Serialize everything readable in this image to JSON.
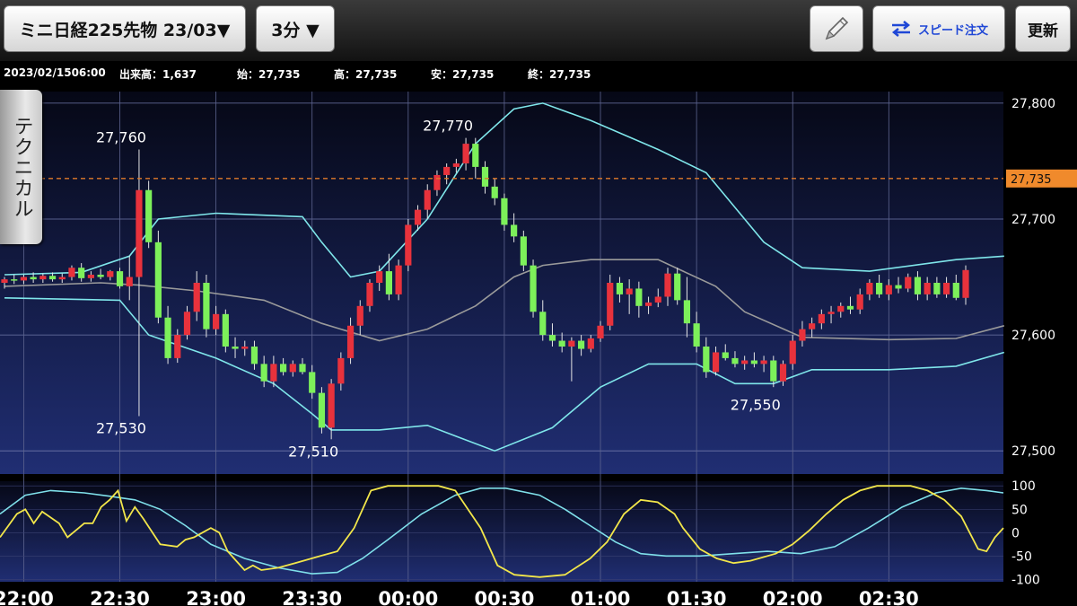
{
  "toolbar": {
    "instrument": "ミニ日経225先物 23/03▼",
    "interval": "3分 ▼",
    "speed_order": "スピード注文",
    "update": "更新"
  },
  "ohlc": {
    "datetime": "2023/02/1506:00",
    "volume": "出来高：1,637",
    "open": "始：27,735",
    "high": "高：27,735",
    "low": "安：27,735",
    "close": "終：27,735"
  },
  "side_tab": "テクニカル",
  "colors": {
    "up": "#e8323c",
    "down": "#7df05a",
    "band": "#7fe6ea",
    "mid": "#9a9a9a",
    "osc_yellow": "#f2e64a",
    "osc_cyan": "#7fe0ea",
    "price_line": "#e07a2a"
  },
  "current_price": "27,735",
  "chart_data": {
    "type": "candlestick",
    "price_axis": {
      "ylim": [
        27480,
        27810
      ],
      "ticks": [
        27800,
        27700,
        27600,
        27500
      ],
      "tick_labels": [
        "27,800",
        "27,700",
        "27,600",
        "27,500"
      ]
    },
    "osc_axis": {
      "ylim": [
        -105,
        110
      ],
      "ticks": [
        100,
        50,
        0,
        -50,
        -100
      ],
      "tick_labels": [
        "100",
        "50",
        "0",
        "-50",
        "-100"
      ]
    },
    "time_labels": [
      {
        "idx": 2,
        "label": "22:00"
      },
      {
        "idx": 12,
        "label": "22:30"
      },
      {
        "idx": 22,
        "label": "23:00"
      },
      {
        "idx": 32,
        "label": "23:30"
      },
      {
        "idx": 42,
        "label": "00:00"
      },
      {
        "idx": 52,
        "label": "00:30"
      },
      {
        "idx": 62,
        "label": "01:00"
      },
      {
        "idx": 72,
        "label": "01:30"
      },
      {
        "idx": 82,
        "label": "02:00"
      },
      {
        "idx": 92,
        "label": "02:30"
      }
    ],
    "annotations": [
      {
        "idx": 14,
        "price": 27760,
        "label": "27,760",
        "pos": "above"
      },
      {
        "idx": 14,
        "price": 27530,
        "label": "27,530",
        "pos": "below"
      },
      {
        "idx": 34,
        "price": 27510,
        "label": "27,510",
        "pos": "below"
      },
      {
        "idx": 48,
        "price": 27770,
        "label": "27,770",
        "pos": "above"
      },
      {
        "idx": 80,
        "price": 27550,
        "label": "27,550",
        "pos": "below"
      }
    ],
    "candles": [
      [
        27645,
        27650,
        27640,
        27648
      ],
      [
        27648,
        27652,
        27644,
        27647
      ],
      [
        27647,
        27652,
        27644,
        27650
      ],
      [
        27650,
        27654,
        27645,
        27648
      ],
      [
        27648,
        27653,
        27645,
        27651
      ],
      [
        27651,
        27654,
        27646,
        27648
      ],
      [
        27648,
        27653,
        27645,
        27650
      ],
      [
        27650,
        27660,
        27647,
        27658
      ],
      [
        27658,
        27662,
        27646,
        27649
      ],
      [
        27649,
        27655,
        27646,
        27652
      ],
      [
        27652,
        27657,
        27648,
        27650
      ],
      [
        27650,
        27656,
        27647,
        27655
      ],
      [
        27655,
        27658,
        27640,
        27642
      ],
      [
        27642,
        27668,
        27630,
        27650
      ],
      [
        27650,
        27760,
        27530,
        27725
      ],
      [
        27725,
        27733,
        27675,
        27680
      ],
      [
        27680,
        27690,
        27610,
        27615
      ],
      [
        27615,
        27625,
        27575,
        27580
      ],
      [
        27580,
        27605,
        27576,
        27600
      ],
      [
        27600,
        27625,
        27596,
        27620
      ],
      [
        27620,
        27655,
        27612,
        27645
      ],
      [
        27645,
        27652,
        27598,
        27605
      ],
      [
        27605,
        27625,
        27600,
        27618
      ],
      [
        27618,
        27622,
        27585,
        27590
      ],
      [
        27590,
        27598,
        27580,
        27588
      ],
      [
        27588,
        27595,
        27582,
        27590
      ],
      [
        27590,
        27595,
        27570,
        27575
      ],
      [
        27575,
        27582,
        27555,
        27560
      ],
      [
        27560,
        27582,
        27555,
        27575
      ],
      [
        27575,
        27580,
        27565,
        27568
      ],
      [
        27568,
        27578,
        27564,
        27575
      ],
      [
        27575,
        27580,
        27566,
        27568
      ],
      [
        27568,
        27574,
        27545,
        27550
      ],
      [
        27550,
        27555,
        27515,
        27520
      ],
      [
        27520,
        27562,
        27510,
        27558
      ],
      [
        27558,
        27585,
        27552,
        27580
      ],
      [
        27580,
        27615,
        27575,
        27608
      ],
      [
        27608,
        27630,
        27600,
        27625
      ],
      [
        27625,
        27648,
        27620,
        27645
      ],
      [
        27645,
        27660,
        27638,
        27655
      ],
      [
        27655,
        27670,
        27630,
        27635
      ],
      [
        27635,
        27665,
        27630,
        27660
      ],
      [
        27660,
        27700,
        27655,
        27695
      ],
      [
        27695,
        27712,
        27690,
        27708
      ],
      [
        27708,
        27730,
        27700,
        27725
      ],
      [
        27725,
        27742,
        27720,
        27738
      ],
      [
        27738,
        27748,
        27730,
        27745
      ],
      [
        27745,
        27752,
        27740,
        27748
      ],
      [
        27748,
        27770,
        27742,
        27765
      ],
      [
        27765,
        27770,
        27735,
        27745
      ],
      [
        27745,
        27750,
        27722,
        27728
      ],
      [
        27728,
        27735,
        27712,
        27718
      ],
      [
        27718,
        27722,
        27690,
        27695
      ],
      [
        27695,
        27705,
        27680,
        27685
      ],
      [
        27685,
        27690,
        27655,
        27660
      ],
      [
        27660,
        27665,
        27615,
        27620
      ],
      [
        27620,
        27630,
        27595,
        27600
      ],
      [
        27600,
        27610,
        27590,
        27595
      ],
      [
        27595,
        27602,
        27585,
        27590
      ],
      [
        27590,
        27598,
        27560,
        27595
      ],
      [
        27595,
        27600,
        27582,
        27588
      ],
      [
        27588,
        27600,
        27585,
        27597
      ],
      [
        27597,
        27612,
        27594,
        27608
      ],
      [
        27608,
        27652,
        27604,
        27645
      ],
      [
        27645,
        27650,
        27628,
        27635
      ],
      [
        27635,
        27648,
        27618,
        27640
      ],
      [
        27640,
        27646,
        27615,
        27625
      ],
      [
        27625,
        27633,
        27618,
        27628
      ],
      [
        27628,
        27640,
        27624,
        27633
      ],
      [
        27633,
        27658,
        27625,
        27653
      ],
      [
        27653,
        27658,
        27626,
        27630
      ],
      [
        27630,
        27650,
        27598,
        27610
      ],
      [
        27610,
        27620,
        27585,
        27590
      ],
      [
        27590,
        27598,
        27563,
        27568
      ],
      [
        27568,
        27590,
        27565,
        27585
      ],
      [
        27585,
        27592,
        27578,
        27580
      ],
      [
        27580,
        27586,
        27572,
        27575
      ],
      [
        27575,
        27582,
        27570,
        27578
      ],
      [
        27578,
        27585,
        27572,
        27575
      ],
      [
        27575,
        27582,
        27568,
        27578
      ],
      [
        27578,
        27582,
        27555,
        27560
      ],
      [
        27560,
        27578,
        27556,
        27575
      ],
      [
        27575,
        27600,
        27570,
        27595
      ],
      [
        27595,
        27612,
        27590,
        27605
      ],
      [
        27605,
        27615,
        27598,
        27610
      ],
      [
        27610,
        27622,
        27605,
        27618
      ],
      [
        27618,
        27625,
        27610,
        27620
      ],
      [
        27620,
        27628,
        27615,
        27625
      ],
      [
        27625,
        27633,
        27618,
        27622
      ],
      [
        27622,
        27640,
        27618,
        27635
      ],
      [
        27635,
        27648,
        27630,
        27645
      ],
      [
        27645,
        27652,
        27632,
        27635
      ],
      [
        27635,
        27648,
        27630,
        27643
      ],
      [
        27643,
        27650,
        27636,
        27640
      ],
      [
        27640,
        27653,
        27637,
        27650
      ],
      [
        27650,
        27655,
        27630,
        27635
      ],
      [
        27635,
        27650,
        27630,
        27645
      ],
      [
        27645,
        27650,
        27632,
        27635
      ],
      [
        27635,
        27650,
        27632,
        27645
      ],
      [
        27645,
        27652,
        27630,
        27632
      ],
      [
        27632,
        27660,
        27626,
        27656
      ]
    ],
    "bollinger": {
      "upper": [
        [
          0,
          27652
        ],
        [
          8,
          27654
        ],
        [
          13,
          27668
        ],
        [
          16,
          27700
        ],
        [
          22,
          27705
        ],
        [
          31,
          27702
        ],
        [
          33,
          27680
        ],
        [
          36,
          27650
        ],
        [
          39,
          27655
        ],
        [
          44,
          27700
        ],
        [
          49,
          27765
        ],
        [
          53,
          27795
        ],
        [
          56,
          27800
        ],
        [
          61,
          27785
        ],
        [
          68,
          27760
        ],
        [
          73,
          27740
        ],
        [
          79,
          27680
        ],
        [
          83,
          27658
        ],
        [
          90,
          27655
        ],
        [
          99,
          27665
        ],
        [
          104,
          27668
        ]
      ],
      "middle": [
        [
          0,
          27642
        ],
        [
          10,
          27645
        ],
        [
          14,
          27643
        ],
        [
          20,
          27638
        ],
        [
          27,
          27630
        ],
        [
          33,
          27610
        ],
        [
          39,
          27595
        ],
        [
          44,
          27605
        ],
        [
          49,
          27625
        ],
        [
          53,
          27650
        ],
        [
          56,
          27660
        ],
        [
          61,
          27665
        ],
        [
          68,
          27665
        ],
        [
          74,
          27642
        ],
        [
          77,
          27620
        ],
        [
          83,
          27598
        ],
        [
          92,
          27596
        ],
        [
          99,
          27597
        ],
        [
          104,
          27608
        ]
      ],
      "lower": [
        [
          0,
          27632
        ],
        [
          12,
          27630
        ],
        [
          15,
          27600
        ],
        [
          22,
          27580
        ],
        [
          28,
          27558
        ],
        [
          32,
          27532
        ],
        [
          34,
          27518
        ],
        [
          39,
          27518
        ],
        [
          44,
          27522
        ],
        [
          51,
          27500
        ],
        [
          57,
          27520
        ],
        [
          62,
          27555
        ],
        [
          67,
          27575
        ],
        [
          72,
          27575
        ],
        [
          76,
          27558
        ],
        [
          80,
          27558
        ],
        [
          84,
          27570
        ],
        [
          92,
          27570
        ],
        [
          99,
          27573
        ],
        [
          104,
          27585
        ]
      ]
    },
    "oscillator": {
      "yellow": [
        [
          0,
          -10
        ],
        [
          2,
          40
        ],
        [
          3,
          50
        ],
        [
          4,
          20
        ],
        [
          5,
          45
        ],
        [
          7,
          20
        ],
        [
          8,
          -10
        ],
        [
          9,
          5
        ],
        [
          10,
          20
        ],
        [
          11,
          20
        ],
        [
          12,
          55
        ],
        [
          13,
          70
        ],
        [
          14,
          90
        ],
        [
          15,
          25
        ],
        [
          16,
          55
        ],
        [
          17,
          30
        ],
        [
          19,
          -25
        ],
        [
          21,
          -30
        ],
        [
          22,
          -15
        ],
        [
          23,
          -10
        ],
        [
          24,
          0
        ],
        [
          25,
          10
        ],
        [
          26,
          0
        ],
        [
          27,
          -40
        ],
        [
          28,
          -60
        ],
        [
          29,
          -80
        ],
        [
          30,
          -70
        ],
        [
          31,
          -80
        ],
        [
          33,
          -75
        ],
        [
          35,
          -65
        ],
        [
          38,
          -50
        ],
        [
          40,
          -40
        ],
        [
          42,
          10
        ],
        [
          44,
          90
        ],
        [
          46,
          100
        ],
        [
          48,
          100
        ],
        [
          52,
          100
        ],
        [
          54,
          90
        ],
        [
          57,
          10
        ],
        [
          59,
          -70
        ],
        [
          61,
          -90
        ],
        [
          64,
          -95
        ],
        [
          67,
          -90
        ],
        [
          70,
          -55
        ],
        [
          72,
          -20
        ],
        [
          74,
          40
        ],
        [
          76,
          70
        ],
        [
          78,
          65
        ],
        [
          80,
          40
        ],
        [
          81,
          10
        ],
        [
          83,
          -35
        ],
        [
          85,
          -55
        ],
        [
          87,
          -65
        ],
        [
          89,
          -60
        ],
        [
          92,
          -45
        ],
        [
          94,
          -25
        ],
        [
          96,
          5
        ],
        [
          98,
          40
        ],
        [
          100,
          70
        ],
        [
          102,
          90
        ],
        [
          104,
          100
        ],
        [
          108,
          100
        ],
        [
          110,
          90
        ],
        [
          112,
          70
        ],
        [
          114,
          35
        ],
        [
          116,
          -35
        ],
        [
          117,
          -40
        ],
        [
          118,
          -10
        ],
        [
          119,
          10
        ]
      ],
      "cyan": [
        [
          0,
          40
        ],
        [
          3,
          80
        ],
        [
          6,
          90
        ],
        [
          10,
          85
        ],
        [
          13,
          78
        ],
        [
          16,
          70
        ],
        [
          19,
          50
        ],
        [
          22,
          15
        ],
        [
          25,
          -25
        ],
        [
          29,
          -55
        ],
        [
          33,
          -75
        ],
        [
          37,
          -88
        ],
        [
          40,
          -85
        ],
        [
          43,
          -55
        ],
        [
          46,
          -15
        ],
        [
          50,
          40
        ],
        [
          54,
          80
        ],
        [
          57,
          95
        ],
        [
          60,
          95
        ],
        [
          64,
          80
        ],
        [
          67,
          50
        ],
        [
          70,
          15
        ],
        [
          73,
          -20
        ],
        [
          76,
          -45
        ],
        [
          79,
          -50
        ],
        [
          83,
          -50
        ],
        [
          87,
          -45
        ],
        [
          91,
          -40
        ],
        [
          95,
          -45
        ],
        [
          99,
          -30
        ],
        [
          103,
          10
        ],
        [
          107,
          55
        ],
        [
          111,
          85
        ],
        [
          114,
          95
        ],
        [
          117,
          90
        ],
        [
          119,
          85
        ]
      ]
    }
  }
}
